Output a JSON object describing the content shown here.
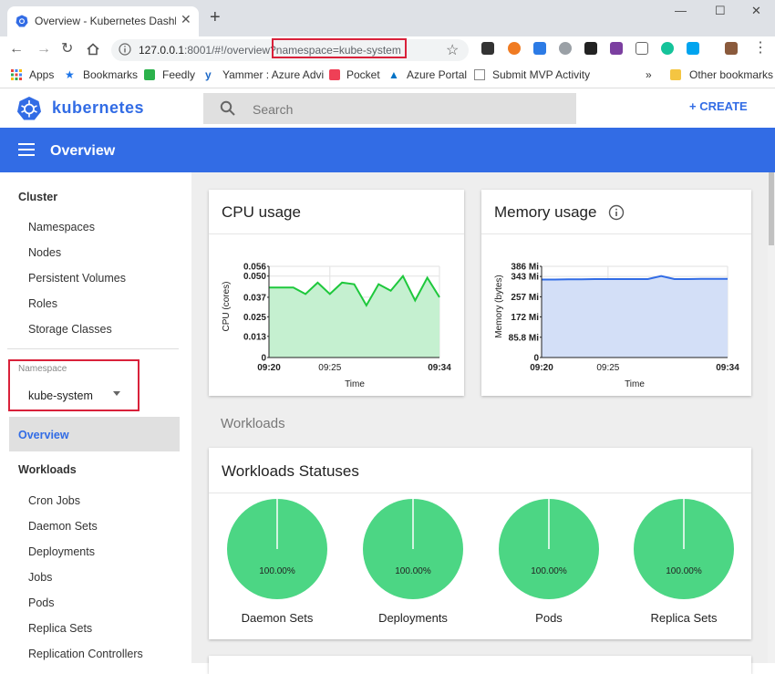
{
  "browser": {
    "tab_title": "Overview - Kubernetes Dashboard",
    "url_prefix": "127.0.0.1",
    "url_rest": ":8001/#!/overview?",
    "url_highlighted": "namespace=kube-system",
    "bookmarks": [
      "Apps",
      "Bookmarks",
      "Feedly",
      "Yammer : Azure Advi",
      "Pocket",
      "Azure Portal",
      "Submit MVP Activity"
    ],
    "more_bookmarks": "»",
    "other_bookmarks": "Other bookmarks"
  },
  "header": {
    "app_name": "kubernetes",
    "search_placeholder": "Search",
    "create_label": "+ CREATE"
  },
  "toolbar": {
    "title": "Overview"
  },
  "sidebar": {
    "cluster_heading": "Cluster",
    "cluster_items": [
      "Namespaces",
      "Nodes",
      "Persistent Volumes",
      "Roles",
      "Storage Classes"
    ],
    "namespace_label": "Namespace",
    "namespace_value": "kube-system",
    "overview_label": "Overview",
    "workloads_heading": "Workloads",
    "workload_items": [
      "Cron Jobs",
      "Daemon Sets",
      "Deployments",
      "Jobs",
      "Pods",
      "Replica Sets",
      "Replication Controllers"
    ]
  },
  "cpu_card": {
    "title": "CPU usage"
  },
  "memory_card": {
    "title": "Memory usage"
  },
  "workloads_heading": "Workloads",
  "statuses_card": {
    "title": "Workloads Statuses"
  },
  "colors": {
    "accent": "#326ce5",
    "success": "#4cd684",
    "cpu_line": "#1ec83c",
    "mem_line": "#326ce5",
    "highlight": "#d9213a"
  },
  "chart_data": [
    {
      "type": "area",
      "title": "CPU usage",
      "xlabel": "Time",
      "ylabel": "CPU (cores)",
      "x_ticks": [
        "09:20",
        "09:25",
        "09:34"
      ],
      "y_ticks": [
        "0",
        "0.013",
        "0.025",
        "0.037",
        "0.050",
        "0.056"
      ],
      "ylim": [
        0,
        0.056
      ],
      "series": [
        {
          "values": [
            0.043,
            0.043,
            0.043,
            0.039,
            0.046,
            0.039,
            0.046,
            0.045,
            0.032,
            0.045,
            0.041,
            0.05,
            0.035,
            0.049,
            0.037
          ]
        }
      ]
    },
    {
      "type": "area",
      "title": "Memory usage",
      "xlabel": "Time",
      "ylabel": "Memory (bytes)",
      "x_ticks": [
        "09:20",
        "09:25",
        "09:34"
      ],
      "y_ticks": [
        "0",
        "85.8 Mi",
        "172 Mi",
        "257 Mi",
        "343 Mi",
        "386 Mi"
      ],
      "ylim": [
        0,
        386
      ],
      "series": [
        {
          "values": [
            330,
            330,
            331,
            331,
            332,
            332,
            332,
            332,
            332,
            345,
            332,
            332,
            333,
            333,
            333
          ]
        }
      ]
    },
    {
      "type": "pie",
      "slices": [
        {
          "label": "Daemon Sets",
          "value": 100,
          "text": "100.00%"
        },
        {
          "label": "Deployments",
          "value": 100,
          "text": "100.00%"
        },
        {
          "label": "Pods",
          "value": 100,
          "text": "100.00%"
        },
        {
          "label": "Replica Sets",
          "value": 100,
          "text": "100.00%"
        }
      ]
    }
  ]
}
